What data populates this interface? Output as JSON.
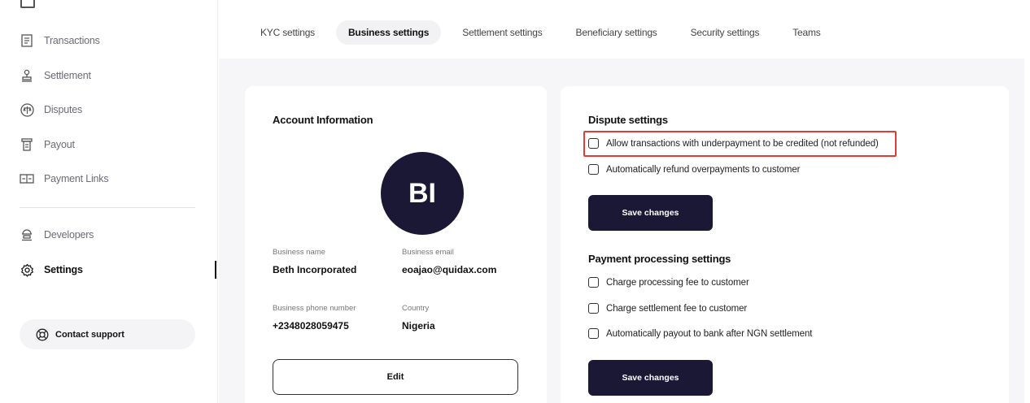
{
  "sidebar": {
    "items": [
      {
        "label": "Transactions",
        "icon": "receipt-icon"
      },
      {
        "label": "Settlement",
        "icon": "stamp-icon"
      },
      {
        "label": "Disputes",
        "icon": "scale-icon"
      },
      {
        "label": "Payout",
        "icon": "payout-icon"
      },
      {
        "label": "Payment Links",
        "icon": "link-icon"
      },
      {
        "label": "Developers",
        "icon": "developer-icon"
      },
      {
        "label": "Settings",
        "icon": "gear-icon"
      }
    ],
    "contact_support": "Contact support"
  },
  "tabs": [
    {
      "label": "KYC settings"
    },
    {
      "label": "Business settings",
      "active": true
    },
    {
      "label": "Settlement settings"
    },
    {
      "label": "Beneficiary settings"
    },
    {
      "label": "Security settings"
    },
    {
      "label": "Teams"
    }
  ],
  "account": {
    "title": "Account Information",
    "avatar_initials": "BI",
    "business_name_label": "Business name",
    "business_name": "Beth Incorporated",
    "business_email_label": "Business email",
    "business_email": "eoajao@quidax.com",
    "phone_label": "Business phone number",
    "phone": "+2348028059475",
    "country_label": "Country",
    "country": "Nigeria",
    "edit_label": "Edit"
  },
  "dispute": {
    "title": "Dispute settings",
    "options": [
      {
        "label": "Allow transactions with underpayment to be credited (not refunded)",
        "checked": false
      },
      {
        "label": "Automatically refund overpayments to customer",
        "checked": false
      }
    ],
    "save_label": "Save changes"
  },
  "payment_processing": {
    "title": "Payment processing settings",
    "options": [
      {
        "label": "Charge processing fee to customer",
        "checked": false
      },
      {
        "label": "Charge settlement fee to customer",
        "checked": false
      },
      {
        "label": "Automatically payout to bank after NGN settlement",
        "checked": false
      }
    ],
    "save_label": "Save changes"
  },
  "colors": {
    "primary": "#1b1836",
    "highlight": "#e23b3b"
  }
}
